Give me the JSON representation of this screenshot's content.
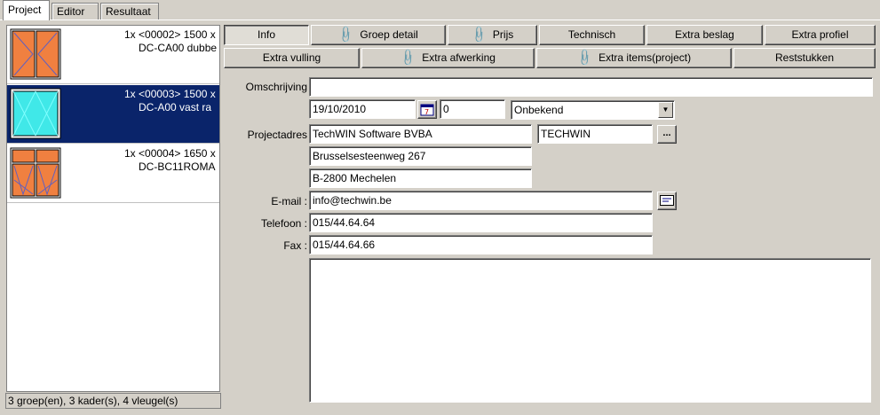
{
  "top_tabs": [
    {
      "label": "Project",
      "active": true
    },
    {
      "label": "Editor",
      "active": false
    },
    {
      "label": "Resultaat",
      "active": false
    }
  ],
  "groups": [
    {
      "line1": "1x <00002> 1500 x",
      "line2": "DC-CA00 dubbe",
      "selected": false,
      "glass_color": "#f08040"
    },
    {
      "line1": "1x <00003> 1500 x",
      "line2": "DC-A00 vast ra",
      "selected": true,
      "glass_color": "#40e0e0"
    },
    {
      "line1": "1x <00004> 1650 x",
      "line2": "DC-BC11ROMA",
      "selected": false,
      "glass_color": "#f08040"
    }
  ],
  "status_bar": "3 groep(en), 3 kader(s), 4 vleugel(s)",
  "buttons_row1": [
    {
      "label": "Info",
      "icon": "",
      "pressed": true
    },
    {
      "label": "Groep detail",
      "icon": "paperclip-icon",
      "pressed": false
    },
    {
      "label": "Prijs",
      "icon": "paperclip-icon",
      "pressed": false
    },
    {
      "label": "Technisch",
      "icon": "",
      "pressed": false
    },
    {
      "label": "Extra beslag",
      "icon": "",
      "pressed": false
    },
    {
      "label": "Extra profiel",
      "icon": "",
      "pressed": false
    }
  ],
  "buttons_row2": [
    {
      "label": "Extra vulling",
      "icon": "",
      "pressed": false
    },
    {
      "label": "Extra afwerking",
      "icon": "paperclip-icon",
      "pressed": false
    },
    {
      "label": "Extra items(project)",
      "icon": "paperclip-icon",
      "pressed": false
    },
    {
      "label": "Reststukken",
      "icon": "",
      "pressed": false
    }
  ],
  "form": {
    "omschrijving_label": "Omschrijving",
    "omschrijving_value": "",
    "date_value": "19/10/2010",
    "number_value": "0",
    "status_value": "Onbekend",
    "projectadres_label": "Projectadres",
    "company_value": "TechWIN Software BVBA",
    "code_value": "TECHWIN",
    "lookup_button": "...",
    "street_value": "Brusselsesteenweg 267",
    "city_value": "B-2800 Mechelen",
    "email_label": "E-mail :",
    "email_value": "info@techwin.be",
    "telefoon_label": "Telefoon :",
    "telefoon_value": "015/44.64.64",
    "fax_label": "Fax :",
    "fax_value": "015/44.64.66",
    "notes_value": ""
  }
}
